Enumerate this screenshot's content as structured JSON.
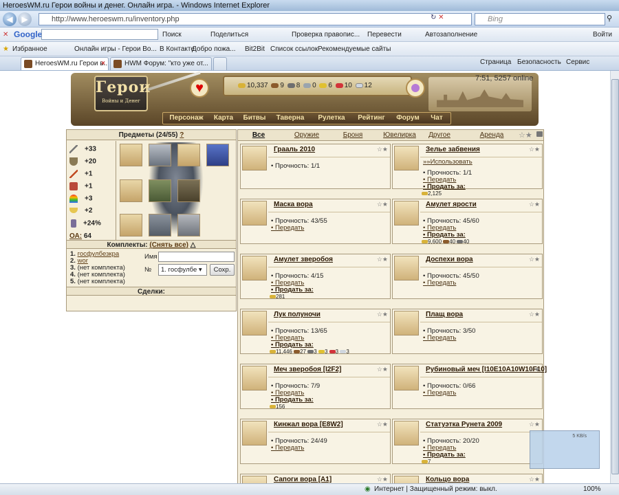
{
  "window": {
    "title": "HeroesWM.ru Герои войны и денег. Онлайн игра. - Windows Internet Explorer"
  },
  "address": {
    "url": "http://www.heroeswm.ru/inventory.php",
    "search_placeholder": "Bing"
  },
  "google_bar": {
    "logo": "Google",
    "search": "Поиск",
    "share": "Поделиться",
    "spell": "Проверка правопис...",
    "translate": "Перевести",
    "autofill": "Автозаполнение",
    "login": "Войти"
  },
  "favorites_bar": {
    "favorites": "Избранное",
    "items": [
      "Онлайн игры - Герои Во...",
      "В Контакте",
      "Добро пожа...",
      "Bit2Bit",
      "Список ссылок",
      "Рекомендуемые сайты"
    ]
  },
  "tabs": [
    {
      "label": "HeroesWM.ru Герои в...",
      "active": true
    },
    {
      "label": "HWM Форум: \"кто уже от...",
      "active": false
    }
  ],
  "command_bar": {
    "page": "Страница",
    "safety": "Безопасность",
    "service": "Сервис"
  },
  "game": {
    "logo_big": "Герои",
    "logo_small": "Войны и Денег",
    "resources": {
      "gold": "10,337",
      "wood": "9",
      "ore": "8",
      "mercury": "0",
      "sulfur": "6",
      "crystals": "10",
      "gems": "12"
    },
    "clock": "7:51, 5257 online",
    "menu": [
      "Персонаж",
      "Карта",
      "Битвы",
      "Таверна",
      "Рулетка",
      "Рейтинг",
      "Форум",
      "Чат"
    ]
  },
  "inventory": {
    "title": "Предметы (24/55)",
    "help": "?",
    "stats": [
      {
        "icon": "attack-icon",
        "value": "+33"
      },
      {
        "icon": "defense-icon",
        "value": "+20"
      },
      {
        "icon": "spellpower-icon",
        "value": "+1"
      },
      {
        "icon": "knowledge-icon",
        "value": "+1"
      },
      {
        "icon": "luck-icon",
        "value": "+3"
      },
      {
        "icon": "morale-icon",
        "value": "+2"
      },
      {
        "icon": "initiative-icon",
        "value": "+24%"
      }
    ],
    "oa_label": "ОА:",
    "oa_value": "64",
    "sets_title": "Комплекты:",
    "sets_clear": "(Снять все)",
    "sets": [
      {
        "num": "1.",
        "name": "госфулбезкра",
        "link": true
      },
      {
        "num": "2.",
        "name": "wor",
        "link": true
      },
      {
        "num": "3.",
        "name": "(нет комплекта)",
        "link": false
      },
      {
        "num": "4.",
        "name": "(нет комплекта)",
        "link": false
      },
      {
        "num": "5.",
        "name": "(нет комплекта)",
        "link": false
      }
    ],
    "set_name_label": "Имя",
    "set_name_value": "",
    "set_num_label": "№",
    "set_num_selected": "1. госфулбе",
    "save_button": "Сохр.",
    "deals_title": "Сделки:"
  },
  "categories": [
    "Все",
    "Оружие",
    "Броня",
    "Ювелирка",
    "Другое",
    "Аренда"
  ],
  "selected_category": "Все",
  "common": {
    "durability": "Прочность:",
    "transfer": "Передать",
    "sell": "Продать за:",
    "use": "»»Использовать"
  },
  "items": [
    {
      "name": "Грааль 2010",
      "durability": "1/1",
      "transfer": false,
      "sell": false,
      "prices": []
    },
    {
      "name": "Зелье забвения",
      "durability": "1/1",
      "use": true,
      "transfer": true,
      "sell": true,
      "prices": [
        {
          "res": "gold",
          "v": "2,125"
        }
      ]
    },
    {
      "name": "Маска вора",
      "durability": "43/55",
      "transfer": true,
      "sell": false,
      "prices": []
    },
    {
      "name": "Амулет ярости",
      "durability": "45/60",
      "transfer": true,
      "sell": true,
      "prices": [
        {
          "res": "gold",
          "v": "9,600"
        },
        {
          "res": "wood",
          "v": "40"
        },
        {
          "res": "ore",
          "v": "40"
        }
      ]
    },
    {
      "name": "Амулет зверобоя",
      "durability": "4/15",
      "transfer": true,
      "sell": true,
      "prices": [
        {
          "res": "gold",
          "v": "281"
        }
      ]
    },
    {
      "name": "Доспехи вора",
      "durability": "45/50",
      "transfer": true,
      "sell": false,
      "prices": []
    },
    {
      "name": "Лук полуночи",
      "durability": "13/65",
      "transfer": true,
      "sell": true,
      "prices": [
        {
          "res": "gold",
          "v": "11,446"
        },
        {
          "res": "wood",
          "v": "27"
        },
        {
          "res": "ore",
          "v": "3"
        },
        {
          "res": "sulfur",
          "v": "3"
        },
        {
          "res": "crystals",
          "v": "3"
        },
        {
          "res": "gems",
          "v": "3"
        }
      ]
    },
    {
      "name": "Плащ вора",
      "durability": "3/50",
      "transfer": true,
      "sell": false,
      "prices": []
    },
    {
      "name": "Меч зверобоя [I2F2]",
      "durability": "7/9",
      "transfer": true,
      "sell": true,
      "prices": [
        {
          "res": "gold",
          "v": "156"
        }
      ]
    },
    {
      "name": "Рубиновый меч [I10E10A10W10F10]",
      "durability": "0/66",
      "transfer": true,
      "sell": false,
      "prices": []
    },
    {
      "name": "Кинжал вора [E8W2]",
      "durability": "24/49",
      "transfer": true,
      "sell": false,
      "prices": []
    },
    {
      "name": "Статуэтка Рунета 2009",
      "durability": "20/20",
      "transfer": true,
      "sell": true,
      "prices": [
        {
          "res": "gold",
          "v": "7"
        }
      ]
    },
    {
      "name": "Сапоги вора [A1]",
      "durability": "",
      "transfer": false,
      "sell": false,
      "prices": []
    },
    {
      "name": "Кольцо вора",
      "durability": "",
      "transfer": false,
      "sell": false,
      "prices": []
    }
  ],
  "net_widget": {
    "speed": "5 KB/s"
  },
  "status": {
    "zone": "Интернет | Защищенный режим: выкл.",
    "zoom": "100%"
  },
  "colors": {
    "menu_text": "#f4e2a9",
    "panel_bg": "#f5efdc",
    "link": "#4a3214"
  }
}
